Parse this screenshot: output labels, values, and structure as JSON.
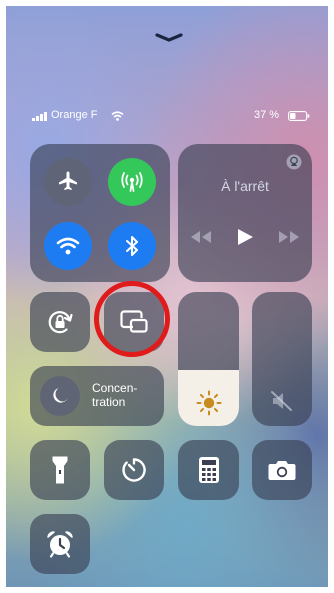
{
  "status_bar": {
    "carrier": "Orange F",
    "battery_text": "37 %",
    "battery_level_percent": 37
  },
  "media": {
    "status": "À l'arrêt"
  },
  "focus": {
    "label": "Concen-\ntration"
  },
  "colors": {
    "cellular_on": "#34c759",
    "wifi_on": "#1e7cf2",
    "bluetooth_on": "#1e7cf2",
    "annotation_circle": "#e01b1b"
  },
  "sliders": {
    "brightness_level": 0.42,
    "volume_level": 0.0
  },
  "icons": [
    "chevron-down-icon",
    "airplane-icon",
    "cellular-icon",
    "wifi-icon",
    "bluetooth-icon",
    "airplay-icon",
    "previous-icon",
    "play-icon",
    "next-icon",
    "orientation-lock-icon",
    "screen-mirroring-icon",
    "moon-icon",
    "sun-icon",
    "speaker-muted-icon",
    "flashlight-icon",
    "timer-icon",
    "calculator-icon",
    "camera-icon",
    "alarm-icon"
  ]
}
